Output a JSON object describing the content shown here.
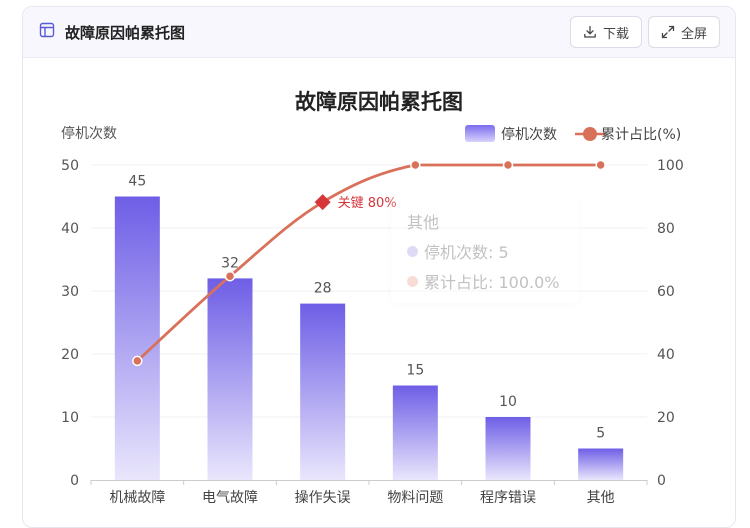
{
  "header": {
    "title": "故障原因帕累托图",
    "download_label": "下载",
    "fullscreen_label": "全屏"
  },
  "chart_data": {
    "type": "bar",
    "title": "故障原因帕累托图",
    "categories": [
      "机械故障",
      "电气故障",
      "操作失误",
      "物料问题",
      "程序错误",
      "其他"
    ],
    "series": [
      {
        "name": "停机次数",
        "type": "bar",
        "axis": "left",
        "values": [
          45,
          32,
          28,
          15,
          10,
          5
        ]
      },
      {
        "name": "累计占比(%)",
        "type": "line",
        "axis": "right",
        "values": [
          37.8,
          64.7,
          88.2,
          100,
          100,
          100
        ]
      }
    ],
    "ylabel": "停机次数",
    "ylim": [
      0,
      50
    ],
    "yticks": [
      0,
      10,
      20,
      30,
      40,
      50
    ],
    "y2lim": [
      0,
      100
    ],
    "y2ticks": [
      0,
      20,
      40,
      60,
      80,
      100
    ],
    "annotation": {
      "label": "关键 80%",
      "value": 88.2
    },
    "legend_position": "top-right",
    "grid": true,
    "colors": {
      "bar_top": "#6e5ee6",
      "bar_bottom": "#e9e6fc",
      "line": "#d9705a",
      "marker": "#d6353a"
    }
  },
  "tooltip": {
    "title": "其他",
    "rows": [
      {
        "text": "停机次数: 5",
        "color": "#b7b0f0"
      },
      {
        "text": "累计占比: 100.0%",
        "color": "#f0b6a8"
      }
    ]
  }
}
